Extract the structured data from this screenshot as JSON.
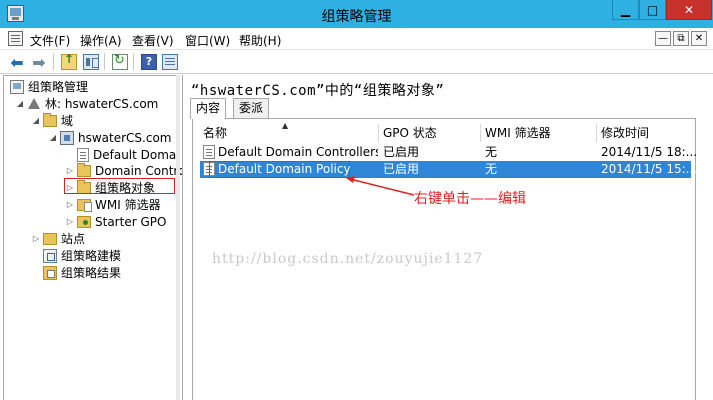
{
  "window": {
    "title": "组策略管理",
    "minimize": "▭",
    "maximize": "□",
    "close": "✕"
  },
  "menubar": {
    "items": [
      "文件(F)",
      "操作(A)",
      "查看(V)",
      "窗口(W)",
      "帮助(H)"
    ],
    "mdi_minimize": "—",
    "mdi_restore": "⧉",
    "mdi_close": "✕"
  },
  "toolbar": {
    "icons": [
      "back-icon",
      "forward-icon",
      "up-folder-icon",
      "show-hide-tree-icon",
      "refresh-icon",
      "help-icon",
      "properties-icon"
    ]
  },
  "tree": {
    "root": "组策略管理",
    "forest": "林: hswaterCS.com",
    "domains": "域",
    "domain": "hswaterCS.com",
    "items": [
      "Default Domai",
      "Domain Contro",
      "组策略对象",
      "WMI 筛选器",
      "Starter GPO"
    ],
    "sites": "站点",
    "modeling": "组策略建模",
    "results": "组策略结果"
  },
  "details": {
    "header": "“hswaterCS.com”中的“组策略对象”",
    "tabs": [
      "内容",
      "委派"
    ],
    "columns": [
      "名称",
      "GPO 状态",
      "WMI 筛选器",
      "修改时间"
    ],
    "rows": [
      {
        "name": "Default Domain Controllers...",
        "status": "已启用",
        "wmi": "无",
        "modified": "2014/11/5 18:..."
      },
      {
        "name": "Default Domain Policy",
        "status": "已启用",
        "wmi": "无",
        "modified": "2014/11/5 15:..."
      }
    ]
  },
  "annotation": {
    "text": "右键单击——编辑",
    "color": "#e02020"
  },
  "watermark": "http://blog.csdn.net/zouyujie1127",
  "colors": {
    "titlebar": "#2fb0e3",
    "close": "#c7302b",
    "selection": "#2f86d6"
  }
}
